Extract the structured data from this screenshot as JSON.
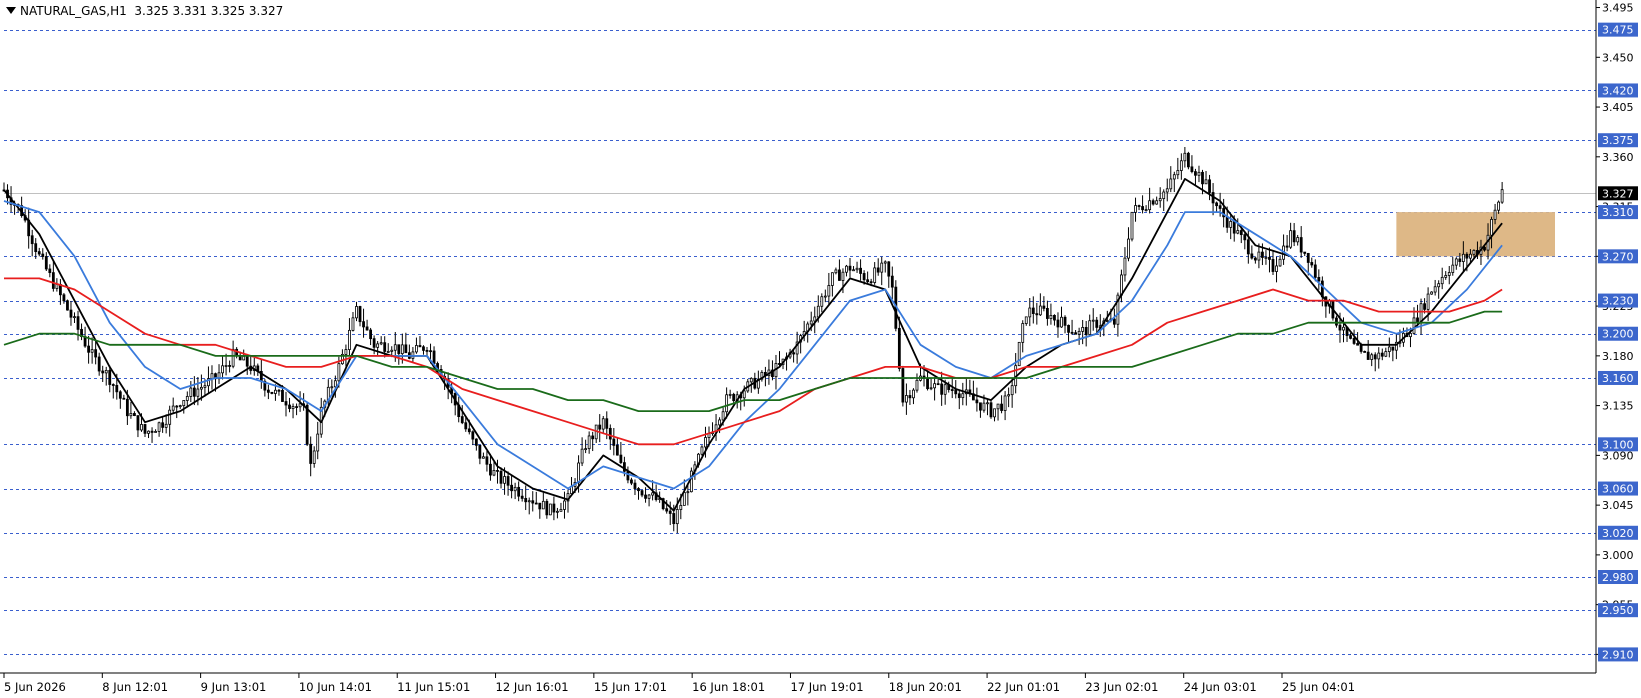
{
  "header": {
    "symbol": "NATURAL_GAS",
    "timeframe": "H1",
    "ohlc": "3.325 3.331 3.325 3.327"
  },
  "colors": {
    "background": "#ffffff",
    "grid_level": "#3a5fcd",
    "label_bg": "#3c66cc",
    "candle": "#000000",
    "ma_fast": "#000000",
    "ma_mid": "#3a7bdc",
    "ma_slow": "#e81e1e",
    "ma_long": "#1a6b1a",
    "zone": "#deb887",
    "current_price_line": "#c0c0c0",
    "current_price_bg": "#000000"
  },
  "chart_data": {
    "type": "candlestick",
    "title": "NATURAL_GAS,H1",
    "ylim": [
      2.895,
      3.5
    ],
    "y_ticks": [
      "3.495",
      "3.450",
      "3.405",
      "3.360",
      "3.315",
      "3.270",
      "3.225",
      "3.180",
      "3.135",
      "3.090",
      "3.045",
      "3.000",
      "2.955",
      "2.910"
    ],
    "level_lines": [
      "3.475",
      "3.420",
      "3.375",
      "3.310",
      "3.270",
      "3.230",
      "3.200",
      "3.160",
      "3.100",
      "3.060",
      "3.020",
      "2.980",
      "2.950",
      "2.910"
    ],
    "current_price": "3.327",
    "x_labels": [
      "5 Jun 2026",
      "8 Jun 12:01",
      "9 Jun 13:01",
      "10 Jun 14:01",
      "11 Jun 15:01",
      "12 Jun 16:01",
      "15 Jun 17:01",
      "16 Jun 18:01",
      "17 Jun 19:01",
      "18 Jun 20:01",
      "22 Jun 01:01",
      "23 Jun 02:01",
      "24 Jun 03:01",
      "25 Jun 04:01"
    ],
    "price_path": [
      [
        0,
        3.33
      ],
      [
        5,
        3.31
      ],
      [
        10,
        3.27
      ],
      [
        15,
        3.24
      ],
      [
        20,
        3.21
      ],
      [
        25,
        3.18
      ],
      [
        30,
        3.16
      ],
      [
        35,
        3.13
      ],
      [
        40,
        3.11
      ],
      [
        45,
        3.12
      ],
      [
        50,
        3.14
      ],
      [
        55,
        3.15
      ],
      [
        60,
        3.16
      ],
      [
        65,
        3.18
      ],
      [
        70,
        3.17
      ],
      [
        75,
        3.15
      ],
      [
        80,
        3.14
      ],
      [
        85,
        3.13
      ],
      [
        87,
        3.08
      ],
      [
        90,
        3.13
      ],
      [
        95,
        3.17
      ],
      [
        100,
        3.22
      ],
      [
        105,
        3.19
      ],
      [
        110,
        3.19
      ],
      [
        115,
        3.18
      ],
      [
        120,
        3.19
      ],
      [
        125,
        3.16
      ],
      [
        130,
        3.12
      ],
      [
        135,
        3.09
      ],
      [
        140,
        3.07
      ],
      [
        145,
        3.06
      ],
      [
        150,
        3.05
      ],
      [
        155,
        3.04
      ],
      [
        160,
        3.05
      ],
      [
        165,
        3.1
      ],
      [
        170,
        3.12
      ],
      [
        175,
        3.08
      ],
      [
        180,
        3.06
      ],
      [
        185,
        3.05
      ],
      [
        190,
        3.03
      ],
      [
        195,
        3.07
      ],
      [
        200,
        3.11
      ],
      [
        205,
        3.14
      ],
      [
        210,
        3.15
      ],
      [
        215,
        3.16
      ],
      [
        220,
        3.17
      ],
      [
        225,
        3.19
      ],
      [
        230,
        3.22
      ],
      [
        235,
        3.25
      ],
      [
        240,
        3.26
      ],
      [
        245,
        3.25
      ],
      [
        250,
        3.26
      ],
      [
        252,
        3.24
      ],
      [
        255,
        3.14
      ],
      [
        260,
        3.16
      ],
      [
        265,
        3.15
      ],
      [
        270,
        3.15
      ],
      [
        275,
        3.14
      ],
      [
        280,
        3.13
      ],
      [
        285,
        3.14
      ],
      [
        290,
        3.22
      ],
      [
        295,
        3.22
      ],
      [
        300,
        3.21
      ],
      [
        305,
        3.2
      ],
      [
        310,
        3.21
      ],
      [
        315,
        3.21
      ],
      [
        320,
        3.31
      ],
      [
        325,
        3.32
      ],
      [
        330,
        3.33
      ],
      [
        335,
        3.36
      ],
      [
        340,
        3.34
      ],
      [
        345,
        3.31
      ],
      [
        350,
        3.29
      ],
      [
        355,
        3.27
      ],
      [
        360,
        3.26
      ],
      [
        365,
        3.29
      ],
      [
        370,
        3.27
      ],
      [
        375,
        3.23
      ],
      [
        380,
        3.2
      ],
      [
        385,
        3.18
      ],
      [
        390,
        3.18
      ],
      [
        395,
        3.19
      ],
      [
        400,
        3.21
      ],
      [
        405,
        3.24
      ],
      [
        410,
        3.26
      ],
      [
        415,
        3.27
      ],
      [
        420,
        3.28
      ],
      [
        425,
        3.33
      ]
    ],
    "series": [
      {
        "name": "",
        "color": "#000000",
        "values": [
          [
            0,
            3.33
          ],
          [
            10,
            3.29
          ],
          [
            20,
            3.23
          ],
          [
            30,
            3.17
          ],
          [
            40,
            3.12
          ],
          [
            50,
            3.13
          ],
          [
            60,
            3.15
          ],
          [
            70,
            3.17
          ],
          [
            80,
            3.15
          ],
          [
            90,
            3.12
          ],
          [
            100,
            3.19
          ],
          [
            110,
            3.18
          ],
          [
            120,
            3.18
          ],
          [
            130,
            3.13
          ],
          [
            140,
            3.08
          ],
          [
            150,
            3.06
          ],
          [
            160,
            3.05
          ],
          [
            170,
            3.09
          ],
          [
            180,
            3.07
          ],
          [
            190,
            3.04
          ],
          [
            200,
            3.1
          ],
          [
            210,
            3.15
          ],
          [
            220,
            3.17
          ],
          [
            230,
            3.21
          ],
          [
            240,
            3.25
          ],
          [
            250,
            3.24
          ],
          [
            260,
            3.17
          ],
          [
            270,
            3.15
          ],
          [
            280,
            3.14
          ],
          [
            290,
            3.17
          ],
          [
            300,
            3.19
          ],
          [
            310,
            3.2
          ],
          [
            320,
            3.25
          ],
          [
            330,
            3.31
          ],
          [
            335,
            3.34
          ],
          [
            345,
            3.32
          ],
          [
            355,
            3.28
          ],
          [
            365,
            3.27
          ],
          [
            375,
            3.23
          ],
          [
            385,
            3.19
          ],
          [
            395,
            3.19
          ],
          [
            405,
            3.22
          ],
          [
            415,
            3.26
          ],
          [
            425,
            3.3
          ]
        ]
      },
      {
        "name": "",
        "color": "#3a7bdc",
        "values": [
          [
            0,
            3.32
          ],
          [
            10,
            3.31
          ],
          [
            20,
            3.27
          ],
          [
            30,
            3.21
          ],
          [
            40,
            3.17
          ],
          [
            50,
            3.15
          ],
          [
            60,
            3.16
          ],
          [
            70,
            3.16
          ],
          [
            80,
            3.15
          ],
          [
            90,
            3.13
          ],
          [
            100,
            3.18
          ],
          [
            110,
            3.18
          ],
          [
            120,
            3.18
          ],
          [
            130,
            3.14
          ],
          [
            140,
            3.1
          ],
          [
            150,
            3.08
          ],
          [
            160,
            3.06
          ],
          [
            170,
            3.08
          ],
          [
            180,
            3.07
          ],
          [
            190,
            3.06
          ],
          [
            200,
            3.08
          ],
          [
            210,
            3.12
          ],
          [
            220,
            3.15
          ],
          [
            230,
            3.19
          ],
          [
            240,
            3.23
          ],
          [
            250,
            3.24
          ],
          [
            260,
            3.19
          ],
          [
            270,
            3.17
          ],
          [
            280,
            3.16
          ],
          [
            290,
            3.18
          ],
          [
            300,
            3.19
          ],
          [
            310,
            3.2
          ],
          [
            320,
            3.23
          ],
          [
            330,
            3.28
          ],
          [
            335,
            3.31
          ],
          [
            345,
            3.31
          ],
          [
            355,
            3.29
          ],
          [
            365,
            3.27
          ],
          [
            375,
            3.24
          ],
          [
            385,
            3.21
          ],
          [
            395,
            3.2
          ],
          [
            405,
            3.21
          ],
          [
            415,
            3.24
          ],
          [
            425,
            3.28
          ]
        ]
      },
      {
        "name": "",
        "color": "#e81e1e",
        "values": [
          [
            0,
            3.25
          ],
          [
            10,
            3.25
          ],
          [
            20,
            3.24
          ],
          [
            30,
            3.22
          ],
          [
            40,
            3.2
          ],
          [
            50,
            3.19
          ],
          [
            60,
            3.19
          ],
          [
            70,
            3.18
          ],
          [
            80,
            3.17
          ],
          [
            90,
            3.17
          ],
          [
            100,
            3.18
          ],
          [
            110,
            3.18
          ],
          [
            120,
            3.17
          ],
          [
            130,
            3.15
          ],
          [
            140,
            3.14
          ],
          [
            150,
            3.13
          ],
          [
            160,
            3.12
          ],
          [
            170,
            3.11
          ],
          [
            180,
            3.1
          ],
          [
            190,
            3.1
          ],
          [
            200,
            3.11
          ],
          [
            210,
            3.12
          ],
          [
            220,
            3.13
          ],
          [
            230,
            3.15
          ],
          [
            240,
            3.16
          ],
          [
            250,
            3.17
          ],
          [
            260,
            3.17
          ],
          [
            270,
            3.16
          ],
          [
            280,
            3.16
          ],
          [
            290,
            3.17
          ],
          [
            300,
            3.17
          ],
          [
            310,
            3.18
          ],
          [
            320,
            3.19
          ],
          [
            330,
            3.21
          ],
          [
            340,
            3.22
          ],
          [
            350,
            3.23
          ],
          [
            360,
            3.24
          ],
          [
            370,
            3.23
          ],
          [
            380,
            3.23
          ],
          [
            390,
            3.22
          ],
          [
            400,
            3.22
          ],
          [
            410,
            3.22
          ],
          [
            420,
            3.23
          ],
          [
            425,
            3.24
          ]
        ]
      },
      {
        "name": "",
        "color": "#1a6b1a",
        "values": [
          [
            0,
            3.19
          ],
          [
            10,
            3.2
          ],
          [
            20,
            3.2
          ],
          [
            30,
            3.19
          ],
          [
            40,
            3.19
          ],
          [
            50,
            3.19
          ],
          [
            60,
            3.18
          ],
          [
            70,
            3.18
          ],
          [
            80,
            3.18
          ],
          [
            90,
            3.18
          ],
          [
            100,
            3.18
          ],
          [
            110,
            3.17
          ],
          [
            120,
            3.17
          ],
          [
            130,
            3.16
          ],
          [
            140,
            3.15
          ],
          [
            150,
            3.15
          ],
          [
            160,
            3.14
          ],
          [
            170,
            3.14
          ],
          [
            180,
            3.13
          ],
          [
            190,
            3.13
          ],
          [
            200,
            3.13
          ],
          [
            210,
            3.14
          ],
          [
            220,
            3.14
          ],
          [
            230,
            3.15
          ],
          [
            240,
            3.16
          ],
          [
            250,
            3.16
          ],
          [
            260,
            3.16
          ],
          [
            270,
            3.16
          ],
          [
            280,
            3.16
          ],
          [
            290,
            3.16
          ],
          [
            300,
            3.17
          ],
          [
            310,
            3.17
          ],
          [
            320,
            3.17
          ],
          [
            330,
            3.18
          ],
          [
            340,
            3.19
          ],
          [
            350,
            3.2
          ],
          [
            360,
            3.2
          ],
          [
            370,
            3.21
          ],
          [
            380,
            3.21
          ],
          [
            390,
            3.21
          ],
          [
            400,
            3.21
          ],
          [
            410,
            3.21
          ],
          [
            420,
            3.22
          ],
          [
            425,
            3.22
          ]
        ]
      }
    ],
    "zones": [
      {
        "from_bar": 395,
        "to_bar": 440,
        "y_low": 3.27,
        "y_high": 3.31
      }
    ],
    "grid": false
  }
}
